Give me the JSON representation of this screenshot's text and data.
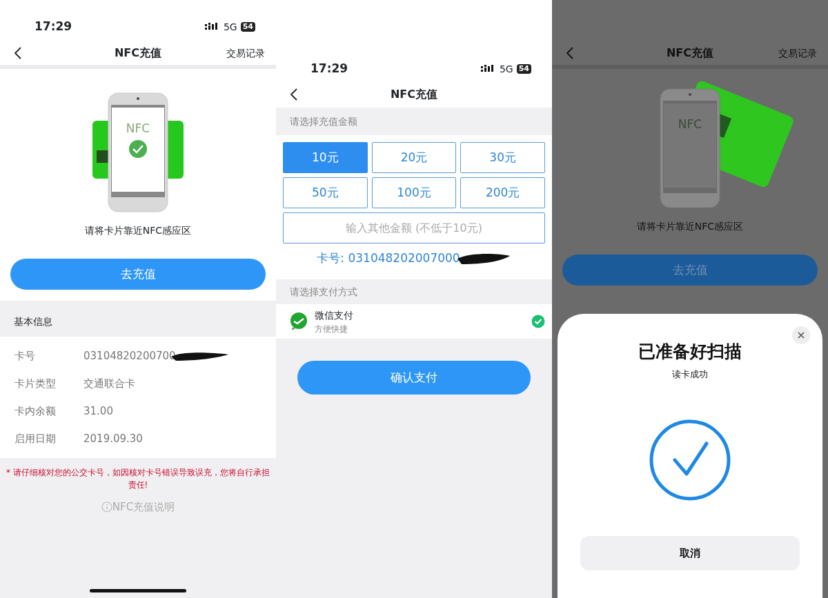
{
  "panel_card_info": {
    "status_bar": {
      "time": "17:29",
      "network": "5G",
      "battery": "54"
    },
    "nav": {
      "title": "NFC充值",
      "action": "交易记录"
    },
    "illustration": {
      "screen_label": "NFC",
      "checked": true
    },
    "hint": "请将卡片靠近NFC感应区",
    "primary_button": "去充值",
    "info_section": {
      "title": "基本信息",
      "rows": [
        {
          "label": "卡号",
          "value": "03104820200700",
          "redacted": true
        },
        {
          "label": "卡片类型",
          "value": "交通联合卡",
          "redacted": false
        },
        {
          "label": "卡内余额",
          "value": "31.00",
          "redacted": false
        },
        {
          "label": "启用日期",
          "value": "2019.09.30",
          "redacted": false
        }
      ]
    },
    "warning": "* 请仔细核对您的公交卡号，如因核对卡号错误导致误充，您将自行承担责任!",
    "help_link": "NFC充值说明"
  },
  "panel_recharge": {
    "status_bar": {
      "time": "17:29",
      "network": "5G",
      "battery": "54"
    },
    "nav": {
      "title": "NFC充值"
    },
    "amount_section": {
      "title": "请选择充值金额",
      "options": [
        {
          "label": "10元",
          "selected": true
        },
        {
          "label": "20元",
          "selected": false
        },
        {
          "label": "30元",
          "selected": false
        },
        {
          "label": "50元",
          "selected": false
        },
        {
          "label": "100元",
          "selected": false
        },
        {
          "label": "200元",
          "selected": false
        }
      ],
      "custom_placeholder": "输入其他金额 (不低于10元)"
    },
    "card_number": "卡号: 031048202007000",
    "payment_section": {
      "title": "请选择支付方式",
      "methods": [
        {
          "name": "微信支付",
          "subtitle": "方便快捷",
          "selected": true
        }
      ]
    },
    "confirm_button": "确认支付"
  },
  "panel_scan_dialog": {
    "background": {
      "nav": {
        "title": "NFC充值",
        "action": "交易记录"
      },
      "illustration": {
        "screen_label": "NFC",
        "checked": false
      },
      "hint": "请将卡片靠近NFC感应区",
      "primary_button": "去充值"
    },
    "sheet": {
      "title": "已准备好扫描",
      "subtitle": "读卡成功",
      "cancel_button": "取消"
    }
  }
}
